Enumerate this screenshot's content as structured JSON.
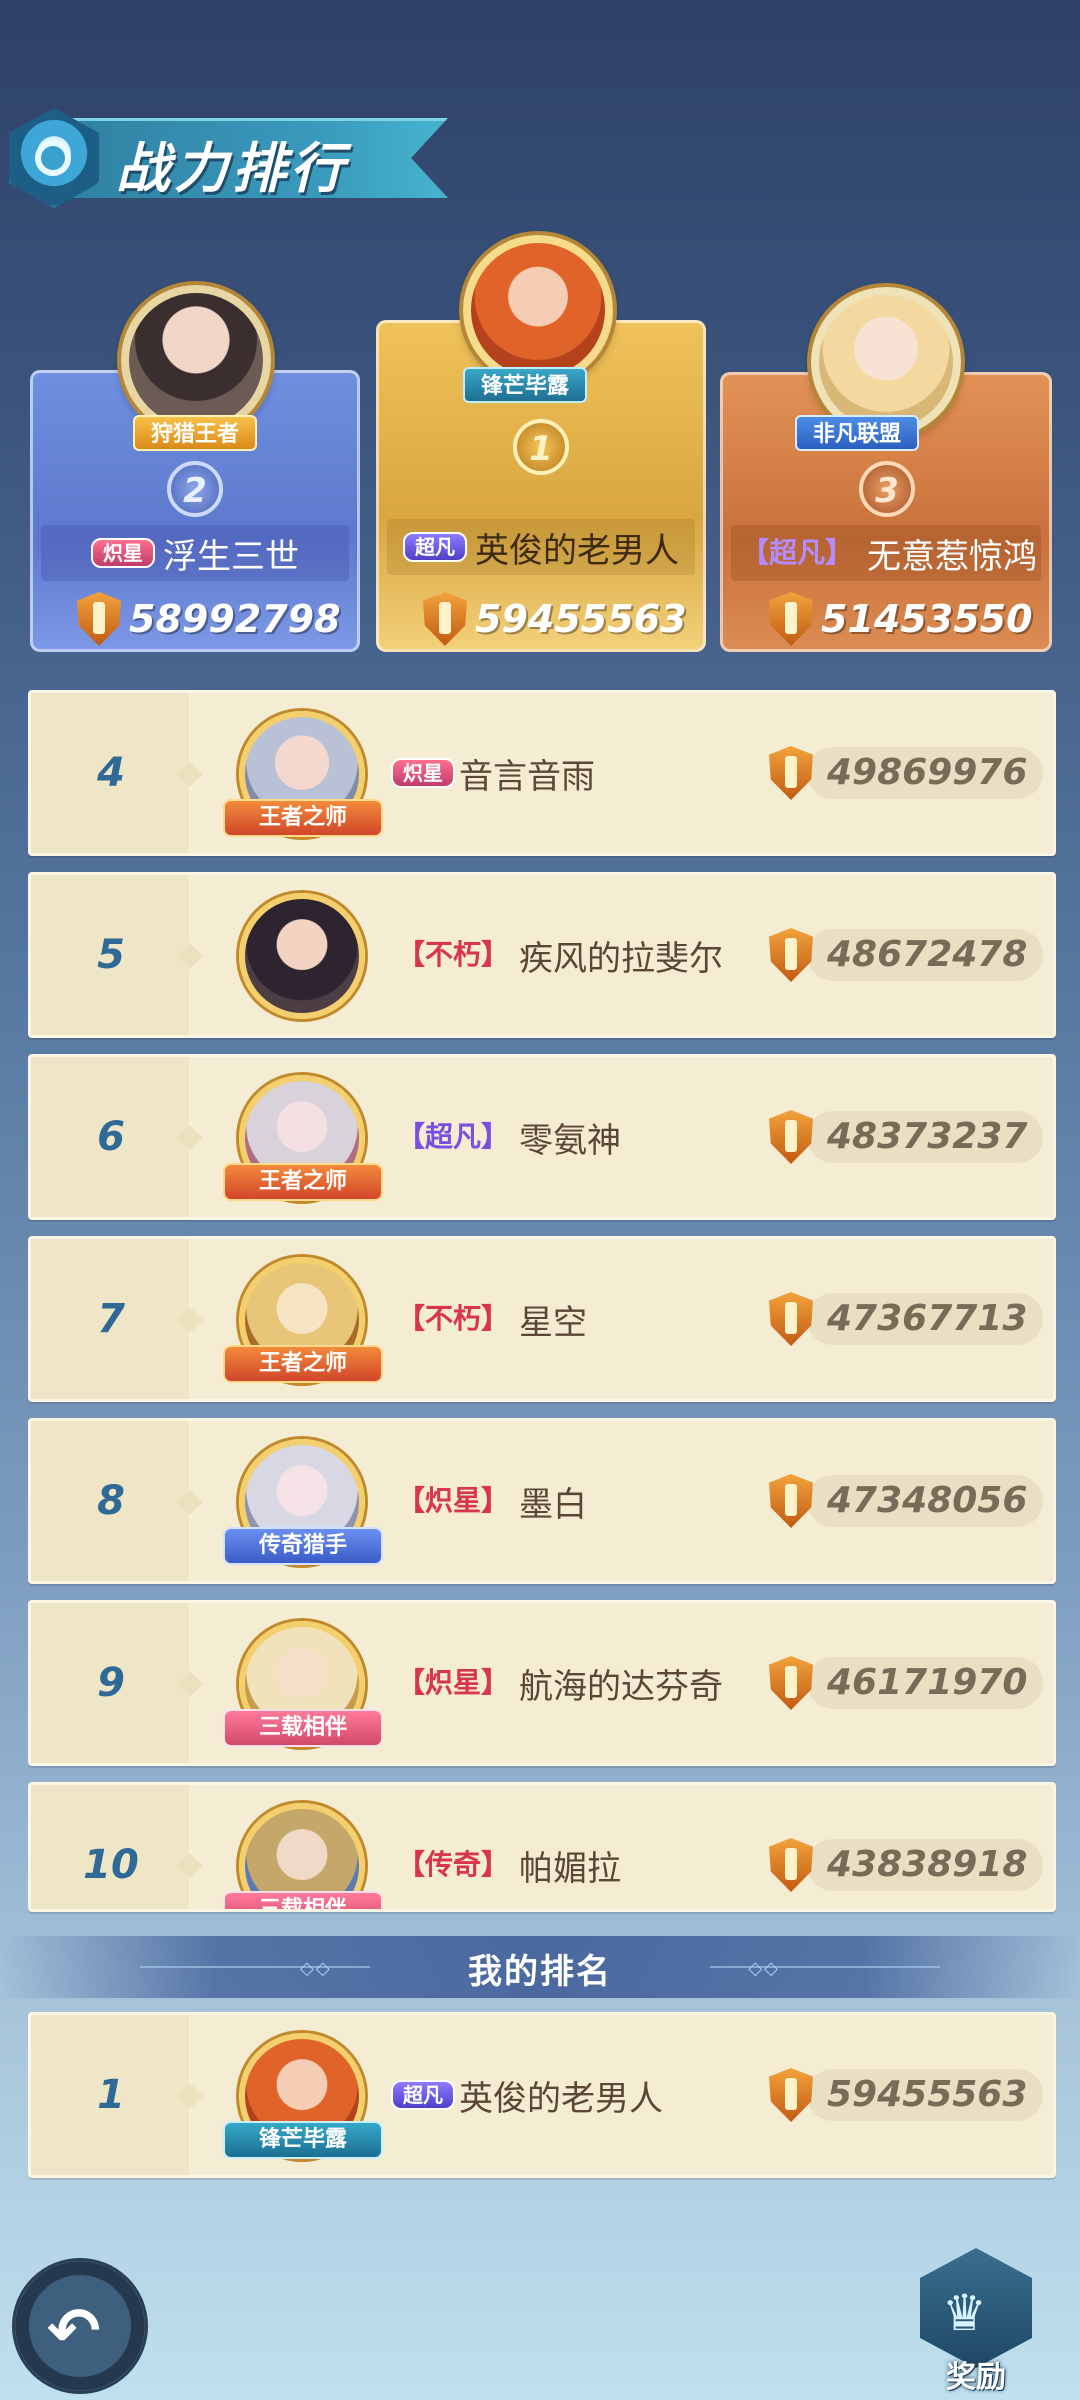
{
  "header": {
    "title": "战力排行"
  },
  "podium": [
    {
      "rank": "2",
      "tag": "狩猎王者",
      "badge": "炽星",
      "name": "浮生三世",
      "power": "58992798"
    },
    {
      "rank": "1",
      "tag": "锋芒毕露",
      "badge": "超凡",
      "name": "英俊的老男人",
      "power": "59455563"
    },
    {
      "rank": "3",
      "tag": "非凡联盟",
      "badge": "【超凡】",
      "name": "无意惹惊鸿",
      "power": "51453550"
    }
  ],
  "list": [
    {
      "rank": "4",
      "avatar_tag": "王者之师",
      "badge": "炽星",
      "name": "音言音雨",
      "power": "49869976"
    },
    {
      "rank": "5",
      "avatar_tag": "",
      "badge": "【不朽】",
      "name": "疾风的拉斐尔",
      "power": "48672478"
    },
    {
      "rank": "6",
      "avatar_tag": "王者之师",
      "badge": "【超凡】",
      "name": "零氨神",
      "power": "48373237"
    },
    {
      "rank": "7",
      "avatar_tag": "王者之师",
      "badge": "【不朽】",
      "name": "星空",
      "power": "47367713"
    },
    {
      "rank": "8",
      "avatar_tag": "传奇猎手",
      "badge": "【炽星】",
      "name": "墨白",
      "power": "47348056"
    },
    {
      "rank": "9",
      "avatar_tag": "三载相伴",
      "badge": "【炽星】",
      "name": "航海的达芬奇",
      "power": "46171970"
    },
    {
      "rank": "10",
      "avatar_tag": "三载相伴",
      "badge": "【传奇】",
      "name": "帕媚拉",
      "power": "43838918"
    }
  ],
  "my_rank": {
    "label": "我的排名",
    "rank": "1",
    "avatar_tag": "锋芒毕露",
    "badge": "超凡",
    "name": "英俊的老男人",
    "power": "59455563"
  },
  "buttons": {
    "back_icon": "back-arrow-icon",
    "reward_label": "奖励",
    "reward_icon": "crown-icon"
  },
  "colors": {
    "rank_number": "#2e6a95",
    "row_bg": "#f4edd4",
    "badge_red": "#d8364a",
    "badge_purple": "#7a4fe0"
  }
}
